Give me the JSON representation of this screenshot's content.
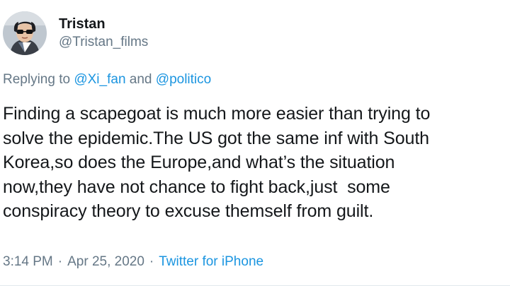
{
  "author": {
    "name": "Tristan",
    "handle": "@Tristan_films",
    "avatar": "profile-photo"
  },
  "reply": {
    "prefix": "Replying to",
    "to_1": "@Xi_fan",
    "joiner": "and",
    "to_2": "@politico"
  },
  "tweet": {
    "text": "Finding a scapegoat is much more easier than trying to\nsolve the epidemic.The US got the same inf with South\nKorea,so does the Europe,and what’s the situation\nnow,they have not chance to fight back,just  some\nconspiracy theory to excuse themself from guilt.",
    "time": "3:14 PM",
    "separator": "·",
    "date": "Apr 25, 2020",
    "source": "Twitter for iPhone"
  },
  "colors": {
    "link": "#1b95e0",
    "secondary_text": "#657786",
    "primary_text": "#14171a"
  }
}
